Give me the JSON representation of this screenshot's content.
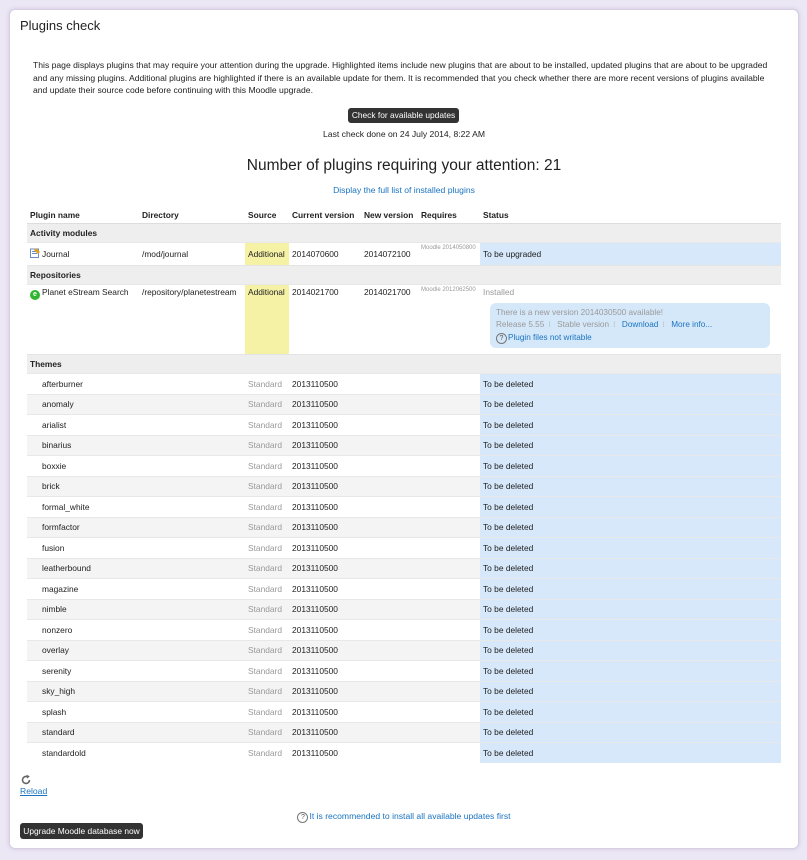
{
  "page": {
    "title": "Plugins check",
    "intro": "This page displays plugins that may require your attention during the upgrade. Highlighted items include new plugins that are about to be installed, updated plugins that are about to be upgraded and any missing plugins. Additional plugins are highlighted if there is an available update for them. It is recommended that you check whether there are more recent versions of plugins available and update their source code before continuing with this Moodle upgrade.",
    "check_button": "Check for available updates",
    "last_check": "Last check done on 24 July 2014, 8:22 AM",
    "heading": "Number of plugins requiring your attention: 21",
    "full_list_link": "Display the full list of installed plugins"
  },
  "table": {
    "headers": [
      "Plugin name",
      "Directory",
      "Source",
      "Current version",
      "New version",
      "Requires",
      "Status"
    ],
    "groups": {
      "activity": "Activity modules",
      "repositories": "Repositories",
      "themes": "Themes"
    },
    "journal": {
      "name": "Journal",
      "directory": "/mod/journal",
      "source": "Additional",
      "current": "2014070600",
      "new": "2014072100",
      "requires": "Moodle 2014050800",
      "status": "To be upgraded"
    },
    "estream": {
      "name": "Planet eStream Search",
      "directory": "/repository/planetestream",
      "source": "Additional",
      "current": "2014021700",
      "new": "2014021700",
      "requires": "Moodle 2012062500",
      "status": "Installed",
      "update_notice": "There is a new version 2014030500 available!",
      "release": "Release 5.55",
      "maturity": "Stable version",
      "download": "Download",
      "more_info": "More info...",
      "not_writable": "Plugin files not writable"
    },
    "theme_source": "Standard",
    "theme_version": "2013110500",
    "theme_status": "To be deleted",
    "themes": [
      "afterburner",
      "anomaly",
      "arialist",
      "binarius",
      "boxxie",
      "brick",
      "formal_white",
      "formfactor",
      "fusion",
      "leatherbound",
      "magazine",
      "nimble",
      "nonzero",
      "overlay",
      "serenity",
      "sky_high",
      "splash",
      "standard",
      "standardold"
    ]
  },
  "footer": {
    "reload": "Reload",
    "recommend": "It is recommended to install all available updates first",
    "upgrade_button": "Upgrade Moodle database now"
  }
}
